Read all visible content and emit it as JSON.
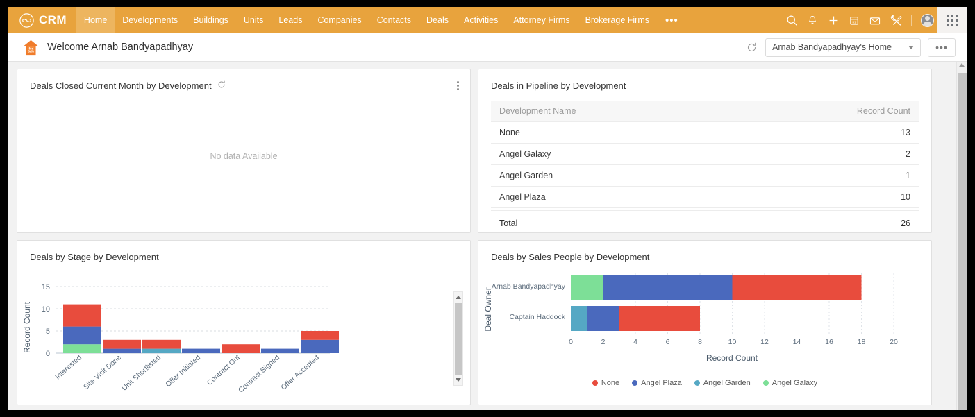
{
  "app": {
    "brand": "CRM",
    "brand_logo_icon": "infinity-loop-icon",
    "accent": "#e8a33d",
    "accent_active": "#edb55f"
  },
  "nav": {
    "items": [
      {
        "label": "Home",
        "active": true
      },
      {
        "label": "Developments",
        "active": false
      },
      {
        "label": "Buildings",
        "active": false
      },
      {
        "label": "Units",
        "active": false
      },
      {
        "label": "Leads",
        "active": false
      },
      {
        "label": "Companies",
        "active": false
      },
      {
        "label": "Contacts",
        "active": false
      },
      {
        "label": "Deals",
        "active": false
      },
      {
        "label": "Activities",
        "active": false
      },
      {
        "label": "Attorney Firms",
        "active": false
      },
      {
        "label": "Brokerage Firms",
        "active": false
      }
    ],
    "more_label": "•••",
    "icons": [
      "search-icon",
      "bell-icon",
      "plus-icon",
      "calendar-icon",
      "envelope-icon",
      "tools-icon"
    ],
    "avatar_icon": "user-avatar-icon",
    "apps_icon": "apps-grid-icon"
  },
  "welcome": {
    "house_icon": "for-sale-house-icon",
    "title": "Welcome Arnab Bandyapadhyay",
    "refresh_icon": "refresh-icon",
    "home_selector": "Arnab Bandyapadhyay's Home",
    "dots_label": "•••"
  },
  "cards": {
    "closed_deals": {
      "title": "Deals Closed Current Month by Development",
      "refresh_icon": "refresh-icon",
      "menu_icon": "kebab-menu-icon",
      "empty_text": "No data Available"
    },
    "pipeline": {
      "title": "Deals in Pipeline by Development",
      "columns": [
        "Development Name",
        "Record Count"
      ],
      "rows": [
        {
          "name": "None",
          "count": "13"
        },
        {
          "name": "Angel Galaxy",
          "count": "2"
        },
        {
          "name": "Angel Garden",
          "count": "1"
        },
        {
          "name": "Angel Plaza",
          "count": "10"
        }
      ],
      "total_label": "Total",
      "total_value": "26"
    },
    "by_stage": {
      "title": "Deals by Stage by Development"
    },
    "by_sales_people": {
      "title": "Deals by Sales People by Development"
    }
  },
  "chart_data": [
    {
      "type": "bar",
      "id": "deals-by-stage",
      "orientation": "vertical",
      "stacked": true,
      "title": "Deals by Stage by Development",
      "xlabel": "",
      "ylabel": "Record Count",
      "ylim": [
        0,
        15
      ],
      "yticks": [
        0,
        5,
        10,
        15
      ],
      "grid": true,
      "categories": [
        "Interested",
        "Site Visit Done",
        "Unit Shortlisted",
        "Offer Initiated",
        "Contract Out",
        "Contract Signed",
        "Offer Accepted"
      ],
      "series": [
        {
          "name": "Angel Galaxy",
          "color": "#7ddf97",
          "values": [
            2,
            0,
            0,
            0,
            0,
            0,
            0
          ]
        },
        {
          "name": "Angel Garden",
          "color": "#55a8c4",
          "values": [
            0,
            0,
            1,
            0,
            0,
            0,
            0
          ]
        },
        {
          "name": "Angel Plaza",
          "color": "#4a69bd",
          "values": [
            4,
            1,
            0,
            1,
            0,
            1,
            3
          ]
        },
        {
          "name": "None",
          "color": "#e84c3d",
          "values": [
            5,
            2,
            2,
            0,
            2,
            0,
            2
          ]
        }
      ],
      "totals": [
        11,
        3,
        3,
        1,
        2,
        1,
        5
      ]
    },
    {
      "type": "bar",
      "id": "deals-by-sales-people",
      "orientation": "horizontal",
      "stacked": true,
      "title": "Deals by Sales People by Development",
      "xlabel": "Record Count",
      "ylabel": "Deal Owner",
      "xlim": [
        0,
        20
      ],
      "xticks": [
        0,
        2,
        4,
        6,
        8,
        10,
        12,
        14,
        16,
        18,
        20
      ],
      "grid": true,
      "legend_position": "bottom",
      "categories": [
        "Arnab Bandyapadhyay",
        "Captain Haddock"
      ],
      "series": [
        {
          "name": "Angel Galaxy",
          "color": "#7ddf97",
          "values": [
            2,
            0
          ]
        },
        {
          "name": "Angel Garden",
          "color": "#55a8c4",
          "values": [
            0,
            1
          ]
        },
        {
          "name": "Angel Plaza",
          "color": "#4a69bd",
          "values": [
            8,
            2
          ]
        },
        {
          "name": "None",
          "color": "#e84c3d",
          "values": [
            8,
            5
          ]
        }
      ],
      "totals": [
        18,
        8
      ],
      "legend": [
        {
          "label": "None",
          "color": "#e84c3d"
        },
        {
          "label": "Angel Plaza",
          "color": "#4a69bd"
        },
        {
          "label": "Angel Garden",
          "color": "#55a8c4"
        },
        {
          "label": "Angel Galaxy",
          "color": "#7ddf97"
        }
      ]
    }
  ]
}
